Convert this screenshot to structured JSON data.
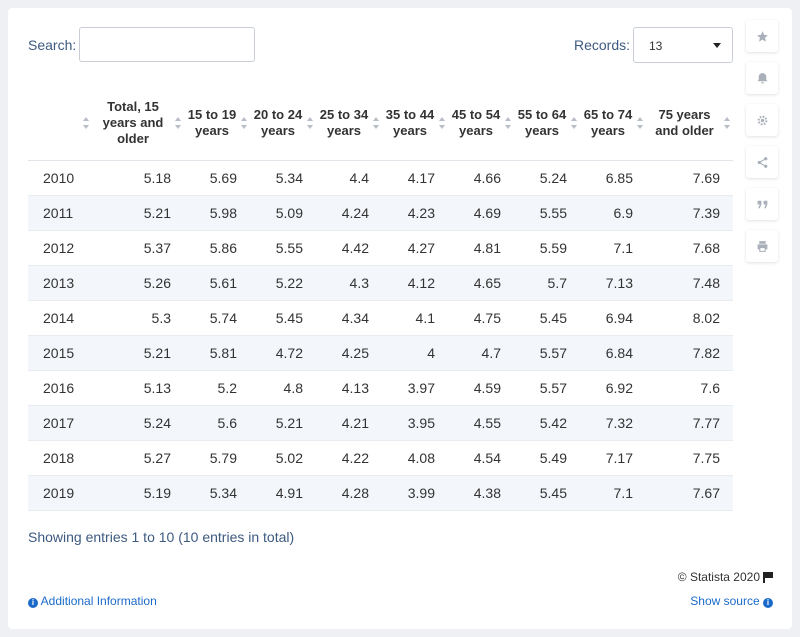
{
  "controls": {
    "search_label": "Search:",
    "search_value": "",
    "records_label": "Records:",
    "records_value": "13"
  },
  "table": {
    "headers": [
      "",
      "Total, 15 years and older",
      "15 to 19 years",
      "20 to 24 years",
      "25 to 34 years",
      "35 to 44 years",
      "45 to 54 years",
      "55 to 64 years",
      "65 to 74 years",
      "75 years and older"
    ],
    "rows": [
      [
        "2010",
        "5.18",
        "5.69",
        "5.34",
        "4.4",
        "4.17",
        "4.66",
        "5.24",
        "6.85",
        "7.69"
      ],
      [
        "2011",
        "5.21",
        "5.98",
        "5.09",
        "4.24",
        "4.23",
        "4.69",
        "5.55",
        "6.9",
        "7.39"
      ],
      [
        "2012",
        "5.37",
        "5.86",
        "5.55",
        "4.42",
        "4.27",
        "4.81",
        "5.59",
        "7.1",
        "7.68"
      ],
      [
        "2013",
        "5.26",
        "5.61",
        "5.22",
        "4.3",
        "4.12",
        "4.65",
        "5.7",
        "7.13",
        "7.48"
      ],
      [
        "2014",
        "5.3",
        "5.74",
        "5.45",
        "4.34",
        "4.1",
        "4.75",
        "5.45",
        "6.94",
        "8.02"
      ],
      [
        "2015",
        "5.21",
        "5.81",
        "4.72",
        "4.25",
        "4",
        "4.7",
        "5.57",
        "6.84",
        "7.82"
      ],
      [
        "2016",
        "5.13",
        "5.2",
        "4.8",
        "4.13",
        "3.97",
        "4.59",
        "5.57",
        "6.92",
        "7.6"
      ],
      [
        "2017",
        "5.24",
        "5.6",
        "5.21",
        "4.21",
        "3.95",
        "4.55",
        "5.42",
        "7.32",
        "7.77"
      ],
      [
        "2018",
        "5.27",
        "5.79",
        "5.02",
        "4.22",
        "4.08",
        "4.54",
        "5.49",
        "7.17",
        "7.75"
      ],
      [
        "2019",
        "5.19",
        "5.34",
        "4.91",
        "4.28",
        "3.99",
        "4.38",
        "5.45",
        "7.1",
        "7.67"
      ]
    ]
  },
  "footer": {
    "showing": "Showing entries 1 to 10 (10 entries in total)",
    "copyright": "© Statista 2020",
    "additional_info": "Additional Information",
    "show_source": "Show source"
  },
  "sidebar": {
    "icons": [
      "star-icon",
      "bell-icon",
      "gear-icon",
      "share-icon",
      "quote-icon",
      "print-icon"
    ]
  },
  "colors": {
    "link": "#1b6ac9",
    "label": "#3d5a80",
    "stripe": "#f3f6fa"
  }
}
